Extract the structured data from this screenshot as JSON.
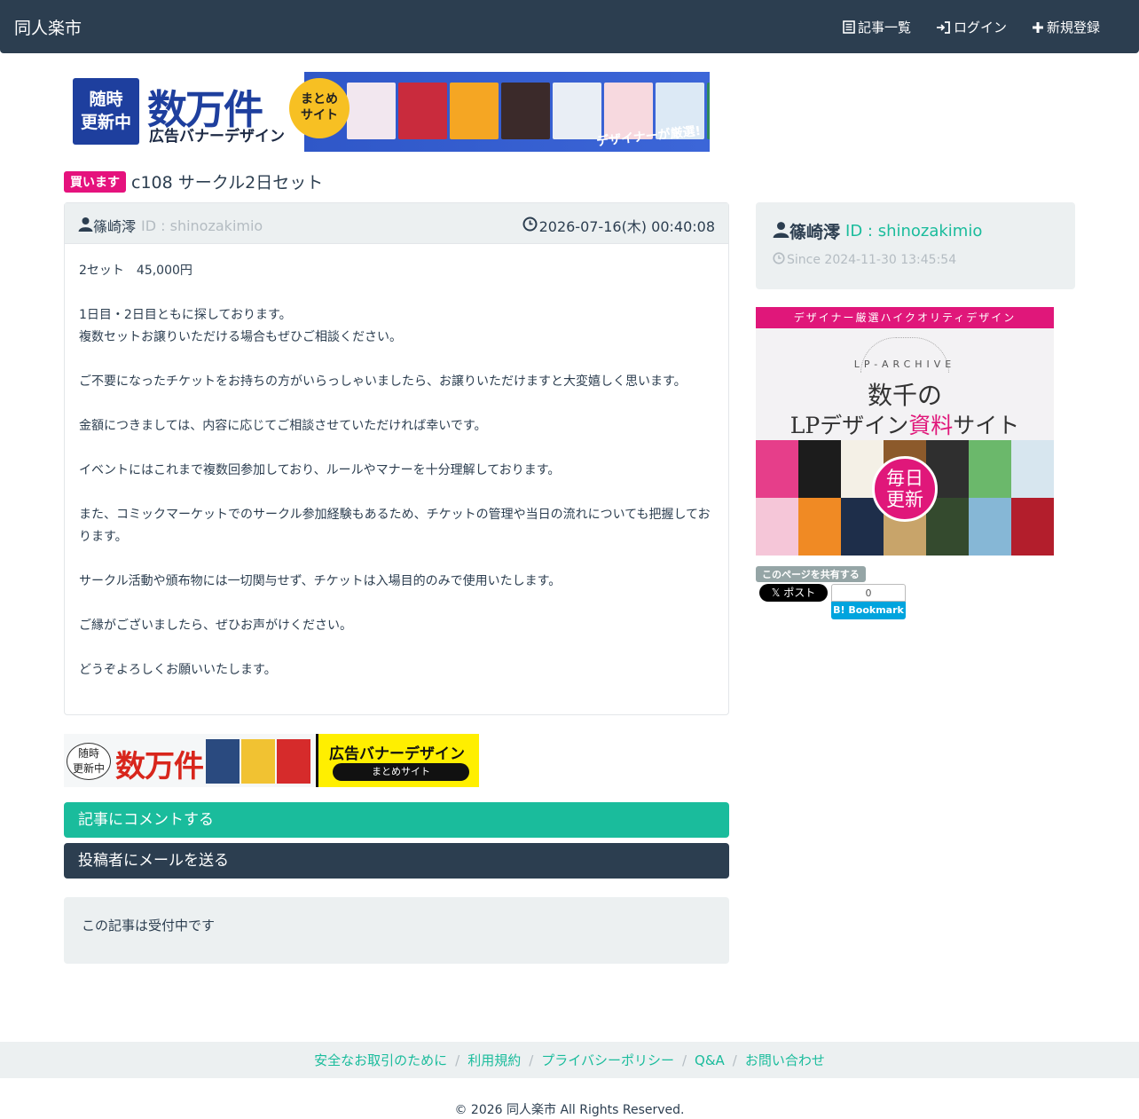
{
  "nav": {
    "brand": "同人楽市",
    "links": [
      {
        "label": "記事一覧",
        "icon": "list-icon"
      },
      {
        "label": "ログイン",
        "icon": "login-icon"
      },
      {
        "label": "新規登録",
        "icon": "plus-icon"
      }
    ]
  },
  "top_banner": {
    "badge": [
      "随時",
      "更新中"
    ],
    "headline": "数万件",
    "subline": "広告バナーデザイン",
    "circle": [
      "まとめ",
      "サイト"
    ],
    "caption": "デザイナーが厳選!",
    "thumb_colors": [
      "#f2e7ef",
      "#c92b3d",
      "#f5a623",
      "#3b2a2a",
      "#e9eef5",
      "#f7d9df",
      "#dce9f5",
      "#2f8a5c"
    ]
  },
  "article": {
    "badge": "買います",
    "title": "c108 サークル2日セット",
    "author": "篠崎澪",
    "author_id": "ID : shinozakimio",
    "date": "2026-07-16(木) 00:40:08",
    "paragraphs": [
      "2セット　45,000円",
      "1日目・2日目ともに探しております。\n複数セットお譲りいただける場合もぜひご相談ください。",
      "ご不要になったチケットをお持ちの方がいらっしゃいましたら、お譲りいただけますと大変嬉しく思います。",
      "金額につきましては、内容に応じてご相談させていただければ幸いです。",
      "イベントにはこれまで複数回参加しており、ルールやマナーを十分理解しております。",
      "また、コミックマーケットでのサークル参加経験もあるため、チケットの管理や当日の流れについても把握しております。",
      "サークル活動や頒布物には一切関与せず、チケットは入場目的のみで使用いたします。",
      "ご縁がございましたら、ぜひお声がけください。",
      "どうぞよろしくお願いいたします。"
    ]
  },
  "bottom_banner": {
    "ring": [
      "随時",
      "更新中"
    ],
    "headline": "数万件",
    "title": "広告バナーデザイン",
    "pill": "まとめサイト",
    "thumb_colors": [
      "#2a4a7f",
      "#f1c232",
      "#d62b2b"
    ]
  },
  "buttons": {
    "comment": "記事にコメントする",
    "mail": "投稿者にメールを送る"
  },
  "status": "この記事は受付中です",
  "sidebar": {
    "author": "篠崎澪",
    "author_id": "ID : shinozakimio",
    "since": "Since 2024-11-30 13:45:54",
    "banner": {
      "top": "デザイナー厳選ハイクオリティデザイン",
      "archive": "LP-ARCHIVE",
      "line1": "数千の",
      "line2_pre": "LPデザイン",
      "line2_pink": "資料",
      "line2_post": "サイト",
      "circle": [
        "毎日",
        "更新"
      ],
      "tile_colors": [
        "#e63e8a",
        "#1c1c1c",
        "#f4f0e6",
        "#8c5a2b",
        "#2f2f2f",
        "#6bb86b",
        "#d7e6ef",
        "#f5c6d8",
        "#f08a24",
        "#1e2e4a",
        "#c8a46a",
        "#344a2e",
        "#86b7d6",
        "#b31e2c"
      ]
    },
    "share_label": "このページを共有する",
    "x_post": "ポスト",
    "hatena_count": "0",
    "hatena_label": "Bookmark"
  },
  "footer": {
    "links": [
      "安全なお取引のために",
      "利用規約",
      "プライバシーポリシー",
      "Q&A",
      "お問い合わせ"
    ],
    "separator": "/",
    "copyright": "© 2026 同人楽市 All Rights Reserved."
  },
  "colors": {
    "navbar": "#2c3e50",
    "accent": "#1abc9c",
    "buy_badge": "#e5127d",
    "muted": "#b4bcc2",
    "well": "#ecf0f1"
  }
}
